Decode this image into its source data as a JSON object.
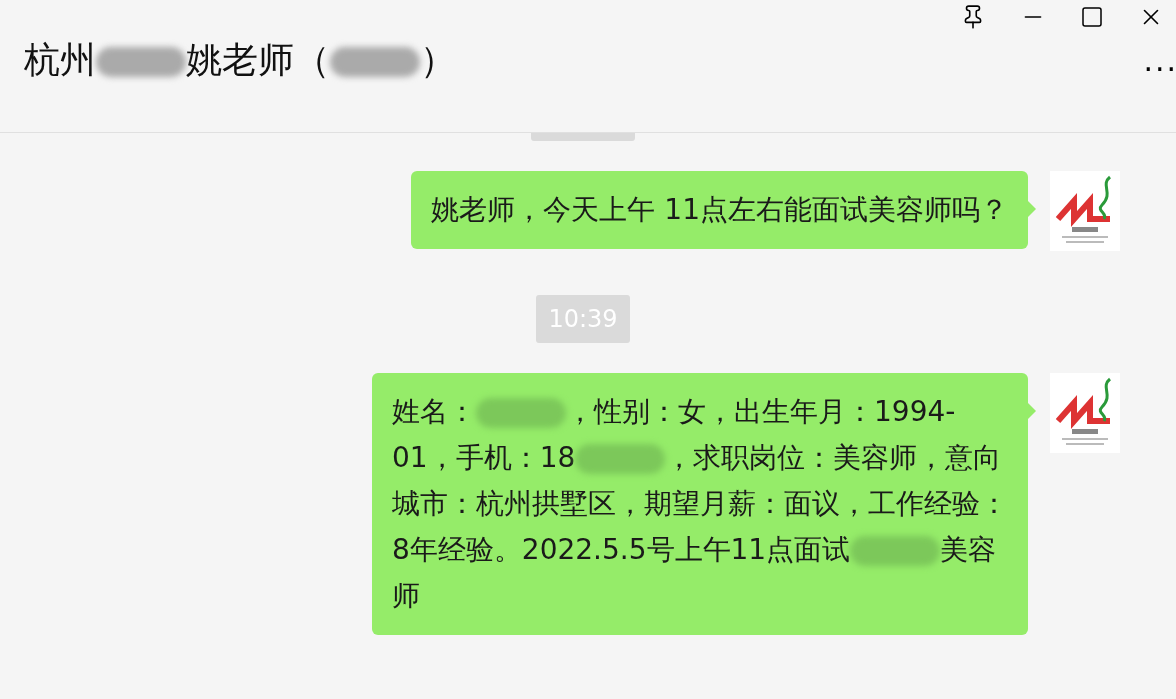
{
  "window": {
    "title": [
      {
        "kind": "text",
        "text": "杭州"
      },
      {
        "kind": "blur"
      },
      {
        "kind": "text",
        "text": "姚老师（"
      },
      {
        "kind": "blur"
      },
      {
        "kind": "text",
        "text": "）"
      }
    ],
    "more": "..."
  },
  "chat": [
    {
      "kind": "time_stub"
    },
    {
      "kind": "message",
      "parts": [
        {
          "kind": "text",
          "text": "姚老师，今天上午 11点左右能面试美容师吗？"
        }
      ]
    },
    {
      "kind": "time",
      "text": "10:39"
    },
    {
      "kind": "message",
      "parts": [
        {
          "kind": "text",
          "text": "姓名："
        },
        {
          "kind": "blur"
        },
        {
          "kind": "text",
          "text": "，性别：女，出生年月：1994-01，手机：18"
        },
        {
          "kind": "blur"
        },
        {
          "kind": "text",
          "text": "，求职岗位：美容师，意向城市：杭州拱墅区，期望月薪：面议，工作经验：8年经验。2022.5.5号上午11点面试"
        },
        {
          "kind": "blur"
        },
        {
          "kind": "text",
          "text": "美容师"
        }
      ]
    }
  ]
}
